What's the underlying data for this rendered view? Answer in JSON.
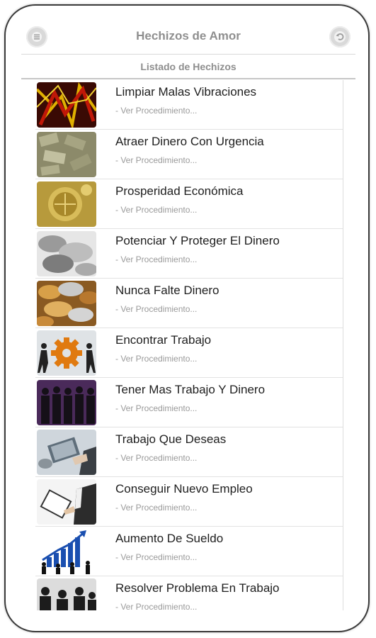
{
  "header": {
    "title": "Hechizos de Amor",
    "menu_icon": "menu-icon",
    "back_icon": "back-icon"
  },
  "subheader": {
    "title": "Listado de Hechizos"
  },
  "items": [
    {
      "title": "Limpiar Malas Vibraciones",
      "subtitle": "- Ver Procedimiento..."
    },
    {
      "title": "Atraer Dinero Con Urgencia",
      "subtitle": "- Ver Procedimiento..."
    },
    {
      "title": "Prosperidad Económica",
      "subtitle": "- Ver Procedimiento..."
    },
    {
      "title": "Potenciar Y Proteger El Dinero",
      "subtitle": "- Ver Procedimiento..."
    },
    {
      "title": "Nunca Falte Dinero",
      "subtitle": "- Ver Procedimiento..."
    },
    {
      "title": "Encontrar Trabajo",
      "subtitle": "- Ver Procedimiento..."
    },
    {
      "title": "Tener Mas Trabajo Y Dinero",
      "subtitle": "- Ver Procedimiento..."
    },
    {
      "title": "Trabajo Que Deseas",
      "subtitle": "- Ver Procedimiento..."
    },
    {
      "title": "Conseguir Nuevo Empleo",
      "subtitle": "- Ver Procedimiento..."
    },
    {
      "title": "Aumento De Sueldo",
      "subtitle": "- Ver Procedimiento..."
    },
    {
      "title": "Resolver Problema En Trabajo",
      "subtitle": "- Ver Procedimiento..."
    }
  ]
}
